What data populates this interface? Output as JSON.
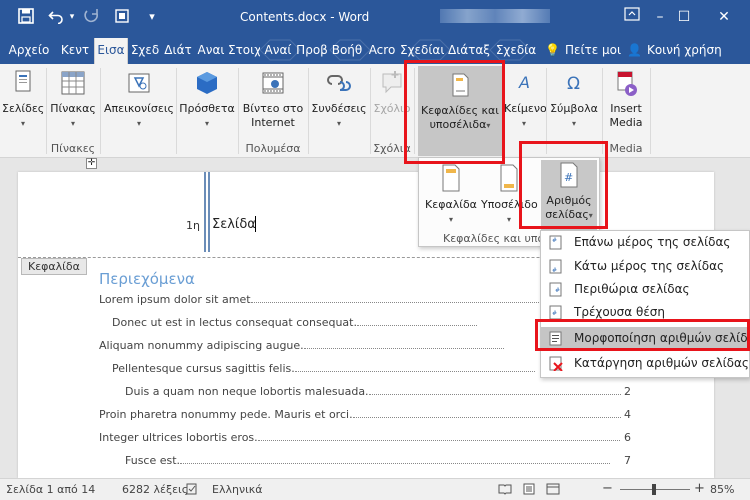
{
  "window": {
    "title": "Contents.docx - Word",
    "colors": {
      "accent": "#2b579a",
      "highlight": "#e8141b"
    }
  },
  "quick_access": {
    "save": "save-icon",
    "undo": "undo-icon",
    "redo": "redo-icon",
    "extra": "touch-mode-icon",
    "customize": "▾"
  },
  "window_controls": {
    "ribbon_options": "ribbon-display-icon",
    "minimize": "–",
    "maximize": "☐",
    "close": "✕"
  },
  "tabs": [
    {
      "label": "Αρχείο"
    },
    {
      "label": "Κεντ"
    },
    {
      "label": "Εισα"
    },
    {
      "label": "Σχεδ"
    },
    {
      "label": "Διάτ"
    },
    {
      "label": "Αναι"
    },
    {
      "label": "Στοιχ"
    },
    {
      "label": "Αναί"
    },
    {
      "label": "Προβ"
    },
    {
      "label": "Βοήθ"
    },
    {
      "label": "Acro"
    },
    {
      "label": "Σχεδίαι"
    },
    {
      "label": "Διάταξ"
    },
    {
      "label": "Σχεδία"
    }
  ],
  "tell_me": "Πείτε μοι",
  "share": "Κοινή χρήση",
  "ribbon": {
    "buttons": {
      "pages": "Σελίδες",
      "table": "Πίνακας",
      "illustrations": "Απεικονίσεις",
      "addins": "Πρόσθετα",
      "video_l1": "Βίντεο στο",
      "video_l2": "Internet",
      "links": "Συνδέσεις",
      "comment": "Σχόλιο",
      "hf_l1": "Κεφαλίδες και",
      "hf_l2": "υποσέλιδα",
      "text": "Κείμενο",
      "symbols": "Σύμβολα",
      "media_l1": "Insert",
      "media_l2": "Media"
    },
    "groups": {
      "tables": "Πίνακες",
      "media": "Πολυμέσα",
      "comments": "Σχόλια",
      "media2": "Media"
    }
  },
  "hf_panel": {
    "header": "Κεφαλίδα",
    "footer": "Υποσέλιδο",
    "page_number_l1": "Αριθμός",
    "page_number_l2": "σελίδας",
    "group": "Κεφαλίδες και υποσέλιδα"
  },
  "page_number_menu": [
    {
      "label": "Επάνω μέρος της σελίδας",
      "icon": "page-top-icon"
    },
    {
      "label": "Κάτω μέρος της σελίδας",
      "icon": "page-bottom-icon"
    },
    {
      "label": "Περιθώρια σελίδας",
      "icon": "page-margins-icon"
    },
    {
      "label": "Τρέχουσα θέση",
      "icon": "current-position-icon"
    },
    {
      "label": "Μορφοποίηση αριθμών σελίδας",
      "icon": "format-page-numbers-icon"
    },
    {
      "label": "Κατάργηση αριθμών σελίδας",
      "icon": "remove-page-numbers-icon"
    }
  ],
  "document": {
    "header_field_number": "1η",
    "header_text": "Σελίδα",
    "header_label": "Κεφαλίδα",
    "toc_title": "Περιεχόμενα",
    "toc": [
      {
        "text": "Lorem ipsum dolor sit amet",
        "page": "1"
      },
      {
        "text": "Donec ut est in lectus consequat consequat.",
        "page": "1"
      },
      {
        "text": "Aliquam nonummy adipiscing augue.",
        "page": "1"
      },
      {
        "text": "Pellentesque cursus sagittis felis.",
        "page": "2"
      },
      {
        "text": "Duis a quam non neque lobortis malesuada.",
        "page": "2"
      },
      {
        "text": "Proin pharetra nonummy pede. Mauris et orci.",
        "page": "4"
      },
      {
        "text": "Integer ultrices lobortis eros.",
        "page": "6"
      },
      {
        "text": "Fusce est.",
        "page": "7"
      }
    ]
  },
  "status": {
    "page": "Σελίδα 1 από 14",
    "words": "6282 λέξεις",
    "language": "Ελληνικά",
    "zoom": "85%",
    "zoom_level": 0.85
  }
}
